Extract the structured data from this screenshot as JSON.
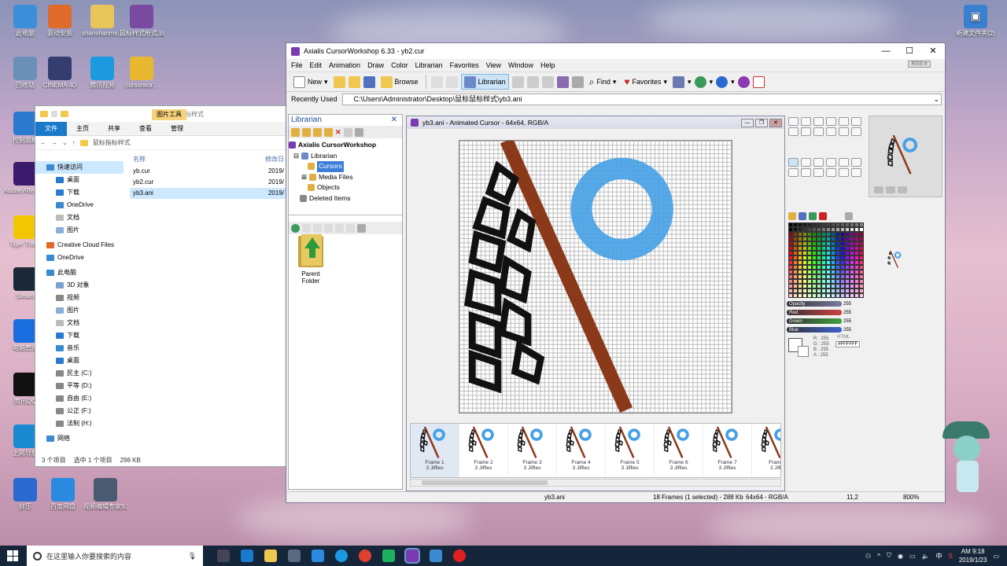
{
  "desktop": {
    "icons_left": [
      {
        "label": "此电脑",
        "color": "#3a8fd8"
      },
      {
        "label": "驱动安装",
        "color": "#e06a2a"
      },
      {
        "label": "shanshanms...",
        "color": "#e8c55a"
      },
      {
        "label": "鼠标样式框式.zip",
        "color": "#7a4aa0"
      },
      {
        "label": "回收站",
        "color": "#6a90b8"
      },
      {
        "label": "CINEMA 4D",
        "color": "#333d70"
      },
      {
        "label": "腾讯视频",
        "color": "#1c9ae0"
      },
      {
        "label": "cursorwor...",
        "color": "#e8b830"
      },
      {
        "label": "控制面板",
        "color": "#2a7ad0"
      },
      {
        "label": "Adobe After Effects CC",
        "color": "#3a1a6a"
      },
      {
        "label": "Tiger Trade",
        "color": "#f2c600"
      },
      {
        "label": "Steam",
        "color": "#1b2838"
      },
      {
        "label": "电脑管家",
        "color": "#1a6fe0"
      },
      {
        "label": "腾讯QQ",
        "color": "#111111"
      },
      {
        "label": "上网导航",
        "color": "#1a8ad0"
      },
      {
        "label": "好压",
        "color": "#2a6ad0"
      },
      {
        "label": "百度网盘",
        "color": "#2a8ae0"
      },
      {
        "label": "视频编辑专家9.2",
        "color": "#4a5a70"
      }
    ],
    "icon_right": {
      "label": "新建文件夹(2)",
      "color": "#3a80d0"
    }
  },
  "explorer": {
    "tabs": [
      "文件",
      "主页",
      "共享",
      "查看",
      "管理"
    ],
    "context_tab": "图片工具",
    "window_title": "鼠标指标样式",
    "address": "鼠标指标样式",
    "nav": [
      {
        "label": "快速访问",
        "sel": true
      },
      {
        "label": "桌面"
      },
      {
        "label": "下载"
      },
      {
        "label": "OneDrive"
      },
      {
        "label": "文档"
      },
      {
        "label": "图片"
      },
      {
        "label": "Creative Cloud Files"
      },
      {
        "label": "OneDrive"
      },
      {
        "label": "此电脑"
      },
      {
        "label": "3D 对象"
      },
      {
        "label": "视频"
      },
      {
        "label": "图片"
      },
      {
        "label": "文档"
      },
      {
        "label": "下载"
      },
      {
        "label": "音乐"
      },
      {
        "label": "桌面"
      },
      {
        "label": "民主 (C:)"
      },
      {
        "label": "平等 (D:)"
      },
      {
        "label": "自由 (E:)"
      },
      {
        "label": "公正 (F:)"
      },
      {
        "label": "法制 (H:)"
      },
      {
        "label": "网络"
      }
    ],
    "col_name": "名称",
    "col_date": "修改日",
    "files": [
      {
        "name": "yb.cur",
        "date": "2019/"
      },
      {
        "name": "yb2.cur",
        "date": "2019/"
      },
      {
        "name": "yb3.ani",
        "date": "2019/",
        "sel": true
      }
    ],
    "status": {
      "count": "3 个项目",
      "selected": "选中 1 个项目",
      "size": "298 KB"
    }
  },
  "app": {
    "title": "Axialis CursorWorkshop 6.33 - yb2.cur",
    "menu": [
      "File",
      "Edit",
      "Animation",
      "Draw",
      "Color",
      "Librarian",
      "Favorites",
      "View",
      "Window",
      "Help"
    ],
    "rss": "RSS fr",
    "toolbar": {
      "new": "New",
      "browse": "Browse",
      "librarian": "Librarian",
      "find": "Find",
      "favorites": "Favorites"
    },
    "recent_label": "Recently Used",
    "recent_path": "C:\\Users\\Administrator\\Desktop\\鼠标鼠标样式\\yb3.ani",
    "librarian": {
      "header": "Librarian",
      "root": "Axialis CursorWorkshop",
      "items": [
        "Librarian",
        "Cursors",
        "Media Files",
        "Objects",
        "Deleted Items"
      ],
      "parent": "Parent Folder"
    },
    "doc": {
      "title": "yb3.ani - Animated Cursor - 64x64, RGB/A",
      "frames": [
        {
          "label": "Frame 1",
          "sub": "3 Jiffies",
          "sel": true
        },
        {
          "label": "Frame 2",
          "sub": "3 Jiffies"
        },
        {
          "label": "Frame 3",
          "sub": "3 Jiffies"
        },
        {
          "label": "Frame 4",
          "sub": "3 Jiffies"
        },
        {
          "label": "Frame 5",
          "sub": "3 Jiffies"
        },
        {
          "label": "Frame 6",
          "sub": "3 Jiffies"
        },
        {
          "label": "Frame 7",
          "sub": "3 Jiffies"
        },
        {
          "label": "Frame",
          "sub": "3 Jiffi"
        }
      ]
    },
    "sliders": [
      {
        "name": "Opacity",
        "value": "255",
        "color": "#7a7aa0"
      },
      {
        "name": "Red",
        "value": "255",
        "color": "#d04040"
      },
      {
        "name": "Green",
        "value": "255",
        "color": "#40a040"
      },
      {
        "name": "Blue",
        "value": "255",
        "color": "#4060d0"
      }
    ],
    "color_info": {
      "r": "R : 255",
      "g": "G : 255",
      "b": "B : 255",
      "a": "A : 255",
      "html_label": "HTML",
      "html": "#FFFFFF"
    },
    "status": {
      "file": "yb3.ani",
      "frames": "18 Frames (1 selected) - 288 Kb",
      "fmt": "64x64 - RGB/A",
      "coord": "11,2",
      "zoom": "800%"
    }
  },
  "taskbar": {
    "search_placeholder": "在这里输入你要搜索的内容",
    "time": "AM 9:18",
    "date": "2019/1/23",
    "ime": "中"
  }
}
